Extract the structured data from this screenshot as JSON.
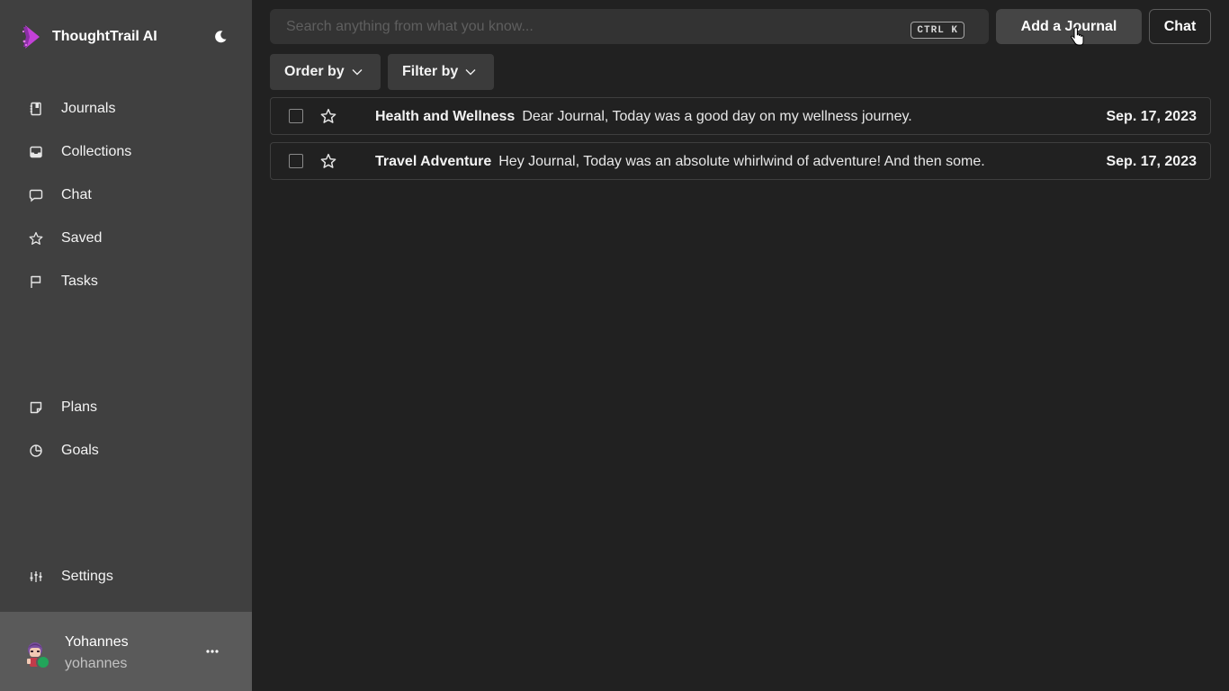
{
  "app": {
    "brand": "ThoughtTrail AI"
  },
  "sidebar": {
    "items": [
      {
        "label": "Journals",
        "icon": "journal-icon"
      },
      {
        "label": "Collections",
        "icon": "inbox-icon"
      },
      {
        "label": "Chat",
        "icon": "chat-bubble-icon"
      },
      {
        "label": "Saved",
        "icon": "star-icon"
      },
      {
        "label": "Tasks",
        "icon": "flag-icon"
      },
      {
        "label": "Plans",
        "icon": "note-icon"
      },
      {
        "label": "Goals",
        "icon": "pie-chart-icon"
      },
      {
        "label": "Settings",
        "icon": "sliders-icon"
      }
    ],
    "user": {
      "name": "Yohannes",
      "handle": "yohannes",
      "status": "online"
    }
  },
  "header": {
    "search_placeholder": "Search anything from what you know...",
    "shortcut": "CTRL K",
    "add_label": "Add a Journal",
    "chat_label": "Chat"
  },
  "filters": {
    "order_label": "Order by",
    "filter_label": "Filter by"
  },
  "journals": [
    {
      "title": "Health and Wellness",
      "snippet": "Dear Journal, Today was a good day on my wellness journey.",
      "date": "Sep. 17, 2023",
      "starred": false
    },
    {
      "title": "Travel Adventure",
      "snippet": "Hey Journal, Today was an absolute whirlwind of adventure! And then some.",
      "date": "Sep. 17, 2023",
      "starred": false
    }
  ],
  "colors": {
    "sidebar_bg": "#404040",
    "main_bg": "#212121",
    "user_box_bg": "#5a5a5a",
    "brand_accent": "#c341d8",
    "online": "#22a55a"
  }
}
